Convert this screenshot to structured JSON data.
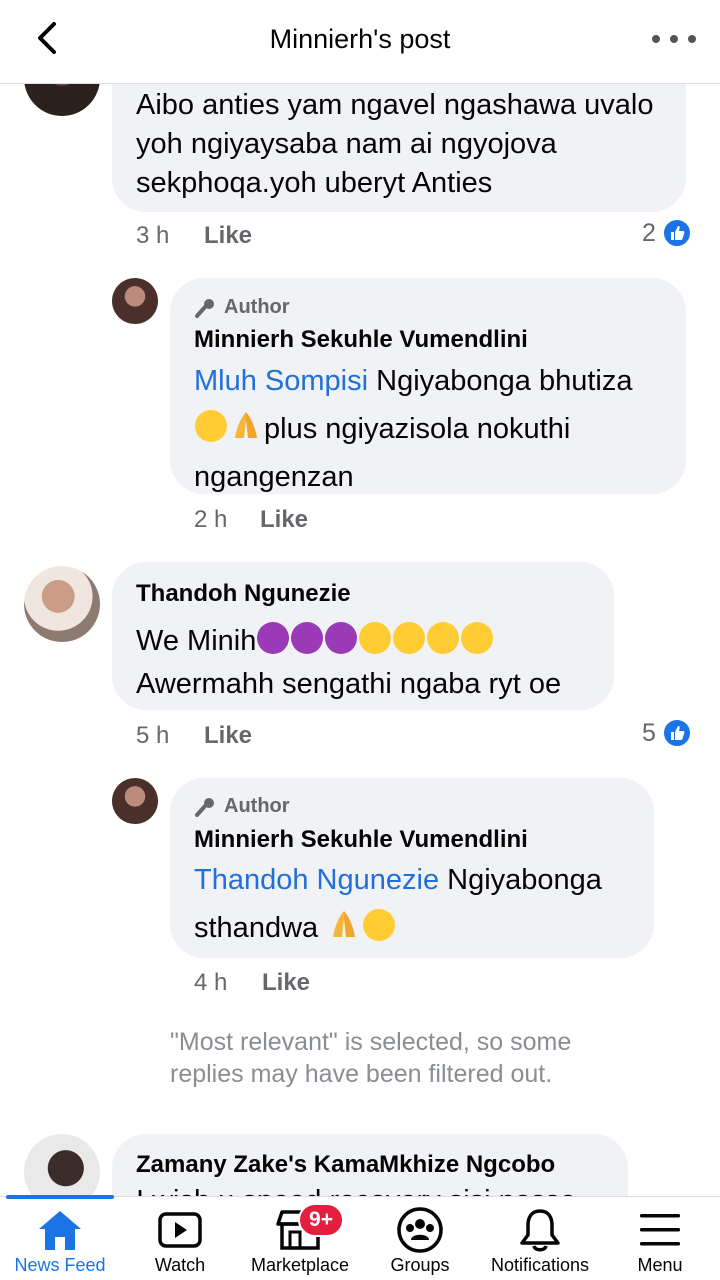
{
  "header": {
    "title": "Minnierh's post"
  },
  "comments": [
    {
      "text": "Aibo anties yam ngavel ngashawa uvalo yoh ngiyaysaba nam ai ngyojova sekphoqa.yoh uberyt Anties",
      "time": "3 h",
      "like": "Like",
      "reactions": "2"
    },
    {
      "badge": "Author",
      "name": "Minnierh Sekuhle Vumendlini",
      "mention": "Mluh Sompisi",
      "text_a": " Ngiyabonga bhutiza",
      "text_b": "plus ngiyazisola nokuthi",
      "text_c": "ngangenzan",
      "time": "2 h",
      "like": "Like"
    },
    {
      "name": "Thandoh Ngunezie",
      "text_a": "We Minih",
      "text_b": "Awermahh sengathi ngaba ryt oe",
      "time": "5 h",
      "like": "Like",
      "reactions": "5"
    },
    {
      "badge": "Author",
      "name": "Minnierh Sekuhle Vumendlini",
      "mention": "Thandoh Ngunezie",
      "text_a": " Ngiyabonga",
      "text_b": "sthandwa ",
      "time": "4 h",
      "like": "Like"
    },
    {
      "name": "Zamany Zake's KamaMkhize Ngcobo",
      "text": "I wish u speed recovery sisi nosse"
    }
  ],
  "filter_note": "\"Most relevant\" is selected, so some replies may have been filtered out.",
  "tabs": [
    {
      "label": "News Feed",
      "icon": "home-icon",
      "active": true
    },
    {
      "label": "Watch",
      "icon": "video-icon"
    },
    {
      "label": "Marketplace",
      "icon": "shop-icon",
      "badge": "9+"
    },
    {
      "label": "Groups",
      "icon": "groups-icon"
    },
    {
      "label": "Notifications",
      "icon": "bell-icon"
    },
    {
      "label": "Menu",
      "icon": "menu-icon"
    }
  ],
  "colors": {
    "accent": "#1b74e4",
    "mention": "#216fdb",
    "bubble": "#f0f2f5",
    "badge_red": "#e41e3f"
  }
}
